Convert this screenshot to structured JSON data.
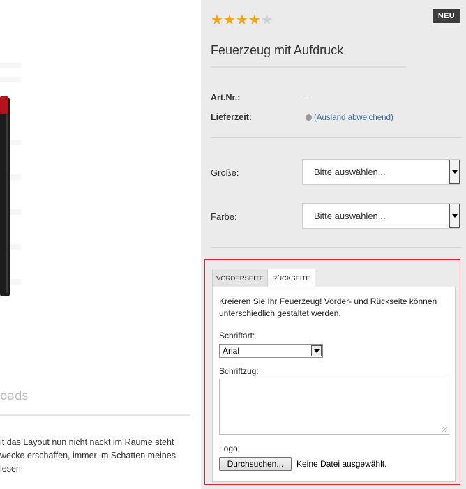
{
  "left": {
    "downloads_heading": "oads",
    "description_lines": [
      "it das Layout nun nicht nackt im Raume steht",
      "wecke erschaffen, immer im Schatten meines",
      "lesen"
    ]
  },
  "product": {
    "badge": "NEU",
    "rating": {
      "value": 4,
      "max": 5
    },
    "title": "Feuerzeug mit Aufdruck",
    "art_nr_label": "Art.Nr.:",
    "art_nr_value": "-",
    "delivery_label": "Lieferzeit:",
    "delivery_value": "(Ausland abweichend)",
    "options": [
      {
        "label": "Größe:",
        "value": "Bitte auswählen..."
      },
      {
        "label": "Farbe:",
        "value": "Bitte auswählen..."
      }
    ]
  },
  "designer": {
    "tabs": [
      "VORDERSEITE",
      "RÜCKSEITE"
    ],
    "active_tab": "RÜCKSEITE",
    "intro": "Kreieren Sie Ihr Feuerzeug! Vorder- und Rückseite können unterschiedlich gestaltet werden.",
    "font_label": "Schriftart:",
    "font_value": "Arial",
    "text_label": "Schriftzug:",
    "text_value": "",
    "logo_label": "Logo:",
    "browse_label": "Durchsuchen...",
    "file_status": "Keine Datei ausgewählt."
  },
  "colors": {
    "star": "#f7a21b",
    "designer_border": "#e2232a",
    "link": "#3b6aa0",
    "badge_bg": "#3d3d3d"
  }
}
